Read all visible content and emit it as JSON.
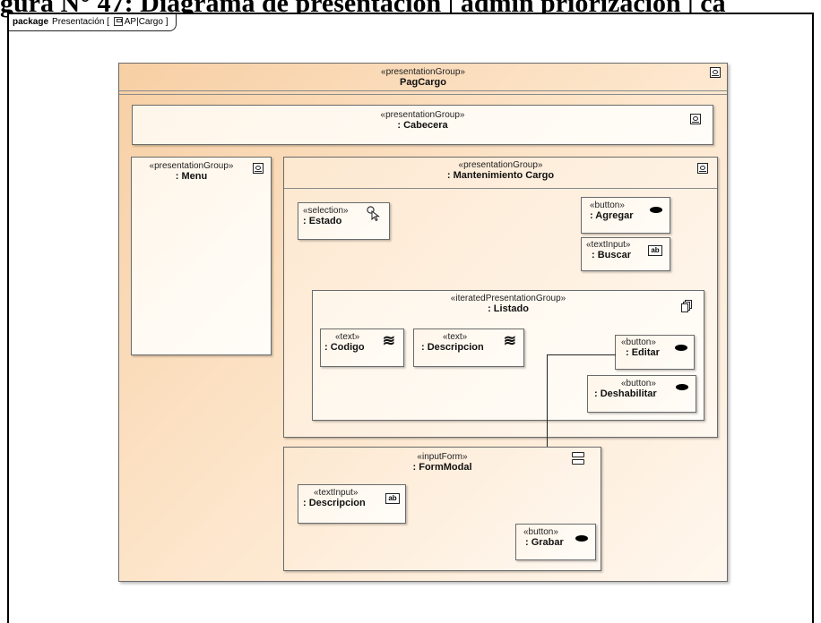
{
  "caption": "gura N° 47: Diagrama de presentación | admin priorización | ca",
  "frame": {
    "keyword": "package",
    "name": "Presentación",
    "path": "AP|Cargo"
  },
  "elements": {
    "pag_cargo": {
      "stereotype": "«presentationGroup»",
      "name": "PagCargo"
    },
    "cabecera": {
      "stereotype": "«presentationGroup»",
      "name": ": Cabecera"
    },
    "menu": {
      "stereotype": "«presentationGroup»",
      "name": ": Menu"
    },
    "mantenimiento": {
      "stereotype": "«presentationGroup»",
      "name": ": Mantenimiento Cargo"
    },
    "estado": {
      "stereotype": "«selection»",
      "name": ": Estado"
    },
    "agregar": {
      "stereotype": "«button»",
      "name": ": Agregar"
    },
    "buscar": {
      "stereotype": "«textInput»",
      "name": ": Buscar"
    },
    "listado": {
      "stereotype": "«iteratedPresentationGroup»",
      "name": ": Listado"
    },
    "codigo": {
      "stereotype": "«text»",
      "name": ": Codigo"
    },
    "descripcion_text": {
      "stereotype": "«text»",
      "name": ": Descripcion"
    },
    "editar": {
      "stereotype": "«button»",
      "name": ": Editar"
    },
    "deshabilitar": {
      "stereotype": "«button»",
      "name": ": Deshabilitar"
    },
    "form_modal": {
      "stereotype": "«inputForm»",
      "name": ": FormModal"
    },
    "descripcion_input": {
      "stereotype": "«textInput»",
      "name": ": Descripcion"
    },
    "grabar": {
      "stereotype": "«button»",
      "name": ": Grabar"
    }
  },
  "icons": {
    "presentation_group": "presentation-group-icon",
    "button": "button-oval-icon",
    "text_input": "textbox-ab-icon",
    "text": "wavy-text-icon",
    "selection": "pointer-selection-icon",
    "iterated_group": "stacked-pages-icon",
    "input_form": "form-icon",
    "diagram": "diagram-icon"
  },
  "icon_glyphs": {
    "text_input": "ab",
    "text": "≋"
  },
  "colors": {
    "outer_fill": "#f7cfa4",
    "inner_fill": "#fff6ea",
    "border": "#6b6b6b"
  }
}
